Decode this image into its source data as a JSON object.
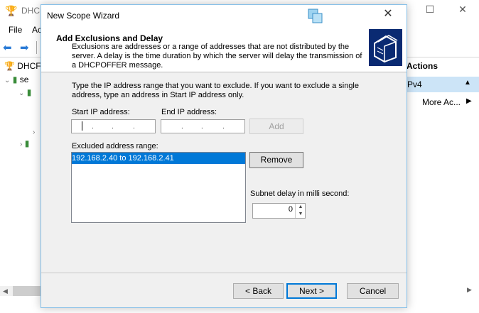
{
  "background": {
    "title": "DHC",
    "menu": {
      "file": "File",
      "action": "Ac"
    },
    "tree": {
      "root": "DHCF",
      "server": "se"
    },
    "actions": {
      "header": "Actions",
      "selected": "Pv4",
      "more": "More Ac..."
    }
  },
  "wizard": {
    "title": "New Scope Wizard",
    "heading": "Add Exclusions and Delay",
    "description": "Exclusions are addresses or a range of addresses that are not distributed by the server. A delay is the time duration by which the server will delay the transmission of a DHCPOFFER message.",
    "instructions": "Type the IP address range that you want to exclude. If you want to exclude a single address, type an address in Start IP address only.",
    "start_ip_label": "Start IP address:",
    "end_ip_label": "End IP address:",
    "start_ip_value": "",
    "end_ip_value": "",
    "add_label": "Add",
    "excluded_label": "Excluded address range:",
    "excluded_items": [
      "192.168.2.40 to 192.168.2.41"
    ],
    "remove_label": "Remove",
    "delay_label": "Subnet delay in milli second:",
    "delay_value": "0",
    "back_label": "< Back",
    "next_label": "Next >",
    "cancel_label": "Cancel"
  },
  "colors": {
    "accent": "#0078d7",
    "header_graphic": "#0a2a72",
    "actions_highlight": "#cce4f7"
  }
}
